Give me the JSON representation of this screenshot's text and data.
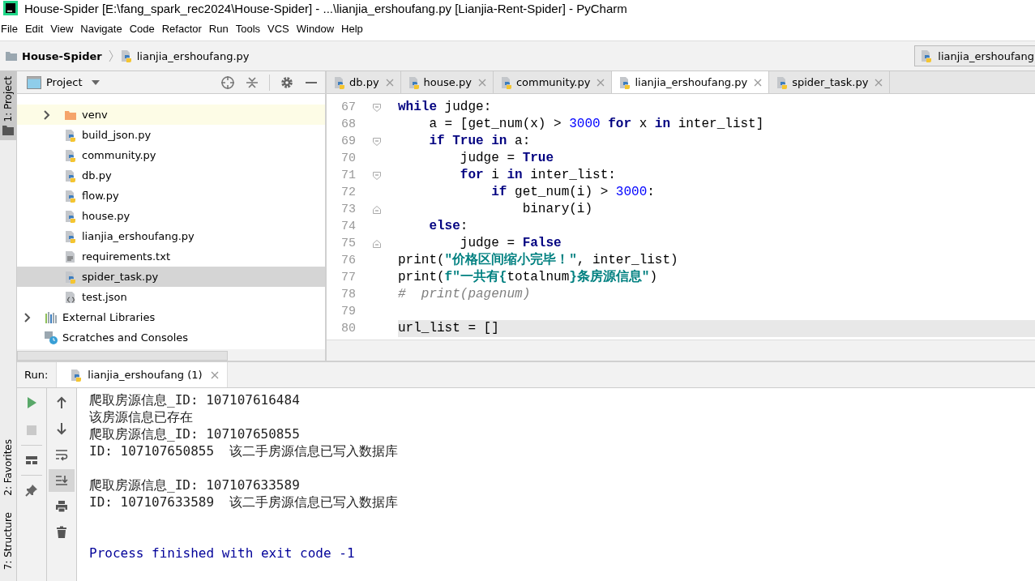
{
  "window": {
    "title": "House-Spider [E:\\fang_spark_rec2024\\House-Spider] - ...\\lianjia_ershoufang.py [Lianjia-Rent-Spider] - PyCharm"
  },
  "menu": [
    "File",
    "Edit",
    "View",
    "Navigate",
    "Code",
    "Refactor",
    "Run",
    "Tools",
    "VCS",
    "Window",
    "Help"
  ],
  "breadcrumbs": [
    {
      "kind": "folder",
      "label": "House-Spider"
    },
    {
      "kind": "py",
      "label": "lianjia_ershoufang.py"
    }
  ],
  "run_config": {
    "label": "lianjia_ershoufang"
  },
  "side_stripe_top": [
    {
      "label": "1: Project",
      "selected": true
    }
  ],
  "side_stripe_bottom": [
    {
      "label": "2: Favorites",
      "selected": false
    },
    {
      "label": "7: Structure",
      "selected": false
    }
  ],
  "project_panel": {
    "title": "Project",
    "files": [
      {
        "label": "venv",
        "kind": "folder",
        "expandable": true,
        "selected": false
      },
      {
        "label": "build_json.py",
        "kind": "py",
        "expandable": false,
        "selected": false
      },
      {
        "label": "community.py",
        "kind": "py",
        "expandable": false,
        "selected": false
      },
      {
        "label": "db.py",
        "kind": "py",
        "expandable": false,
        "selected": false
      },
      {
        "label": "flow.py",
        "kind": "py",
        "expandable": false,
        "selected": false
      },
      {
        "label": "house.py",
        "kind": "py",
        "expandable": false,
        "selected": false
      },
      {
        "label": "lianjia_ershoufang.py",
        "kind": "py",
        "expandable": false,
        "selected": false
      },
      {
        "label": "requirements.txt",
        "kind": "txt",
        "expandable": false,
        "selected": false
      },
      {
        "label": "spider_task.py",
        "kind": "py",
        "expandable": false,
        "selected": true
      },
      {
        "label": "test.json",
        "kind": "json",
        "expandable": false,
        "selected": false
      }
    ],
    "roots": [
      {
        "label": "External Libraries",
        "kind": "libraries",
        "expandable": true
      },
      {
        "label": "Scratches and Consoles",
        "kind": "scratches",
        "expandable": false
      }
    ]
  },
  "editor_tabs": [
    {
      "label": "db.py",
      "selected": false
    },
    {
      "label": "house.py",
      "selected": false
    },
    {
      "label": "community.py",
      "selected": false
    },
    {
      "label": "lianjia_ershoufang.py",
      "selected": true
    },
    {
      "label": "spider_task.py",
      "selected": false
    }
  ],
  "code_lines": [
    {
      "number": "67",
      "fold_start": true,
      "fold_end": false,
      "current": false,
      "tokens": [
        {
          "kind": "kw",
          "text": "while"
        },
        {
          "kind": "plain",
          "text": " judge:"
        }
      ],
      "children": [
        {
          "number": "68",
          "fold_start": false,
          "fold_end": false,
          "current": false,
          "tokens": [
            {
              "kind": "plain",
              "text": "a = [get_num(x) > "
            },
            {
              "kind": "num",
              "text": "3000"
            },
            {
              "kind": "kw",
              "text": " for"
            },
            {
              "kind": "plain",
              "text": " x "
            },
            {
              "kind": "kw",
              "text": "in"
            },
            {
              "kind": "plain",
              "text": " inter_list]"
            }
          ]
        },
        {
          "number": "69",
          "fold_start": true,
          "fold_end": false,
          "current": false,
          "tokens": [
            {
              "kind": "kw",
              "text": "if True in"
            },
            {
              "kind": "plain",
              "text": " a:"
            }
          ],
          "children": [
            {
              "number": "70",
              "fold_start": false,
              "fold_end": false,
              "current": false,
              "tokens": [
                {
                  "kind": "plain",
                  "text": "judge = "
                },
                {
                  "kind": "kw",
                  "text": "True"
                }
              ]
            },
            {
              "number": "71",
              "fold_start": true,
              "fold_end": false,
              "current": false,
              "tokens": [
                {
                  "kind": "kw",
                  "text": "for"
                },
                {
                  "kind": "plain",
                  "text": " i "
                },
                {
                  "kind": "kw",
                  "text": "in"
                },
                {
                  "kind": "plain",
                  "text": " inter_list:"
                }
              ],
              "children": [
                {
                  "number": "72",
                  "fold_start": false,
                  "fold_end": false,
                  "current": false,
                  "tokens": [
                    {
                      "kind": "kw",
                      "text": "if"
                    },
                    {
                      "kind": "plain",
                      "text": " get_num(i) > "
                    },
                    {
                      "kind": "num",
                      "text": "3000"
                    },
                    {
                      "kind": "plain",
                      "text": ":"
                    }
                  ],
                  "children": [
                    {
                      "number": "73",
                      "fold_start": false,
                      "fold_end": true,
                      "current": false,
                      "tokens": [
                        {
                          "kind": "plain",
                          "text": "binary(i)"
                        }
                      ]
                    }
                  ]
                }
              ]
            }
          ]
        },
        {
          "number": "74",
          "fold_start": false,
          "fold_end": false,
          "current": false,
          "tokens": [
            {
              "kind": "kw",
              "text": "else"
            },
            {
              "kind": "plain",
              "text": ":"
            }
          ],
          "children": [
            {
              "number": "75",
              "fold_start": false,
              "fold_end": true,
              "current": false,
              "tokens": [
                {
                  "kind": "plain",
                  "text": "judge = "
                },
                {
                  "kind": "kw",
                  "text": "False"
                }
              ]
            }
          ]
        }
      ]
    },
    {
      "number": "76",
      "fold_start": false,
      "fold_end": false,
      "current": false,
      "tokens": [
        {
          "kind": "plain",
          "text": "print("
        },
        {
          "kind": "str",
          "text": "\"价格区间缩小完毕！\""
        },
        {
          "kind": "plain",
          "text": ", inter_list)"
        }
      ]
    },
    {
      "number": "77",
      "fold_start": false,
      "fold_end": false,
      "current": false,
      "tokens": [
        {
          "kind": "plain",
          "text": "print("
        },
        {
          "kind": "str",
          "text": "f\"一共有{"
        },
        {
          "kind": "plain",
          "text": "totalnum"
        },
        {
          "kind": "str",
          "text": "}条房源信息\""
        },
        {
          "kind": "plain",
          "text": ")"
        }
      ]
    },
    {
      "number": "78",
      "fold_start": false,
      "fold_end": false,
      "current": false,
      "tokens": [
        {
          "kind": "comment",
          "text": "#  print(pagenum)"
        }
      ]
    },
    {
      "number": "79",
      "fold_start": false,
      "fold_end": false,
      "current": false
    },
    {
      "number": "80",
      "fold_start": false,
      "fold_end": false,
      "current": true,
      "tokens": [
        {
          "kind": "plain",
          "text": "url_list = []"
        }
      ]
    }
  ],
  "run_panel": {
    "label": "Run:",
    "tab": "lianjia_ershoufang (1)",
    "console": [
      {
        "kind": "out",
        "text": "爬取房源信息_ID: 107107616484"
      },
      {
        "kind": "out",
        "text": "该房源信息已存在"
      },
      {
        "kind": "out",
        "text": "爬取房源信息_ID: 107107650855"
      },
      {
        "kind": "out",
        "text": "ID: 107107650855  该二手房源信息已写入数据库"
      },
      {
        "kind": "blank"
      },
      {
        "kind": "out",
        "text": "爬取房源信息_ID: 107107633589"
      },
      {
        "kind": "out",
        "text": "ID: 107107633589  该二手房源信息已写入数据库"
      },
      {
        "kind": "blank"
      },
      {
        "kind": "blank"
      },
      {
        "kind": "exit",
        "text": "Process finished with exit code -1"
      }
    ]
  }
}
